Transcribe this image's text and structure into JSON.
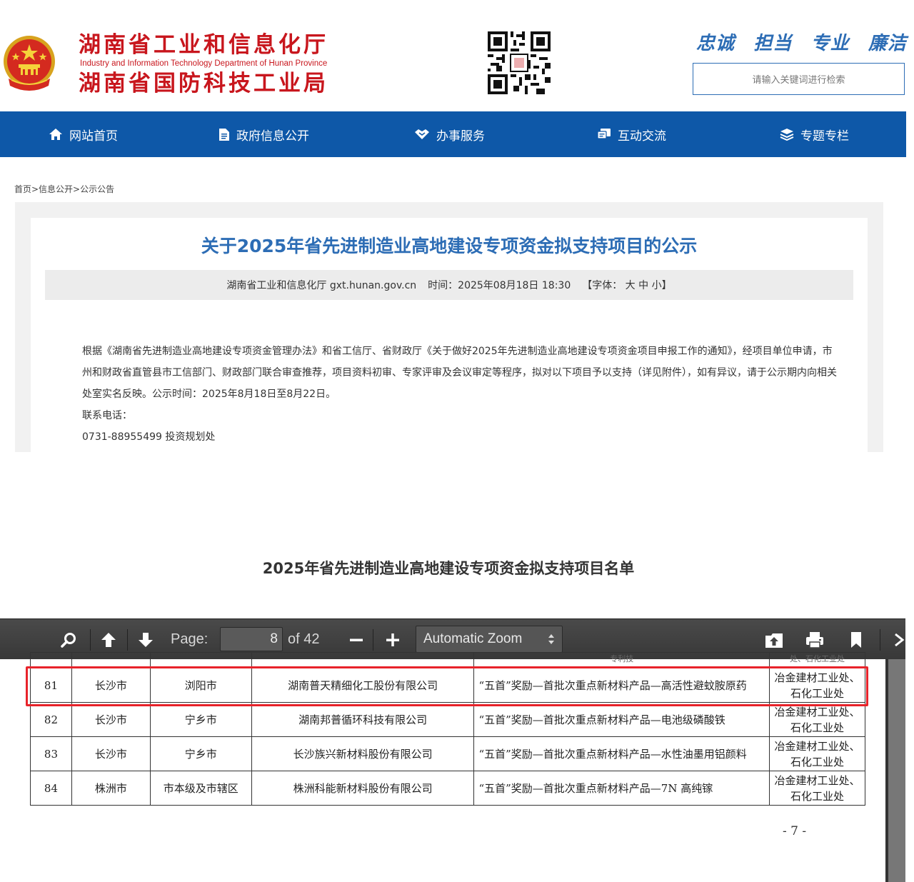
{
  "header": {
    "org_name_1": "湖南省工业和信息化厅",
    "org_name_en": "Industry and Information Technology Department of Hunan Province",
    "org_name_2": "湖南省国防科技工业局",
    "motto": [
      "忠诚",
      "担当",
      "专业",
      "廉洁"
    ],
    "search_placeholder": "请输入关键词进行检索"
  },
  "nav": {
    "items": [
      {
        "label": "网站首页",
        "icon": "home-icon"
      },
      {
        "label": "政府信息公开",
        "icon": "document-icon"
      },
      {
        "label": "办事服务",
        "icon": "handshake-icon"
      },
      {
        "label": "互动交流",
        "icon": "chat-icon"
      },
      {
        "label": "专题专栏",
        "icon": "layers-icon"
      }
    ]
  },
  "breadcrumb": "首页>信息公开>公示公告",
  "article": {
    "title": "关于2025年省先进制造业高地建设专项资金拟支持项目的公示",
    "source": "湖南省工业和信息化厅 gxt.hunan.gov.cn",
    "time": "时间：2025年08月18日 18:30",
    "font_size": "【字体：  大  中  小】",
    "paragraph_1": "根据《湖南省先进制造业高地建设专项资金管理办法》和省工信厅、省财政厅《关于做好2025年先进制造业高地建设专项资金项目申报工作的通知》，经项目单位申请，市州和财政省直管县市工信部门、财政部门联合审查推荐，项目资料初审、专家评审及会议审定等程序，拟对以下项目予以支持（详见附件），如有异议，请于公示期内向相关处室实名反映。公示时间：2025年8月18日至8月22日。",
    "contact_label": "联系电话：",
    "contact_phone": "0731-88955499  投资规划处"
  },
  "list_title": "2025年省先进制造业高地建设专项资金拟支持项目名单",
  "pdf_toolbar": {
    "page_label": "Page:",
    "page_value": "8",
    "page_total": "of 42",
    "zoom": "Automatic Zoom"
  },
  "table": {
    "top_partial": [
      "",
      "",
      "",
      "",
      "专利技",
      "处、石化工业处"
    ],
    "rows": [
      {
        "no": "81",
        "city": "长沙市",
        "county": "浏阳市",
        "company": "湖南普天精细化工股份有限公司",
        "project": "“五首”奖励—首批次重点新材料产品—高活性避蚊胺原药",
        "dept": "冶金建材工业处、石化工业处"
      },
      {
        "no": "82",
        "city": "长沙市",
        "county": "宁乡市",
        "company": "湖南邦普循环科技有限公司",
        "project": "“五首”奖励—首批次重点新材料产品—电池级磷酸铁",
        "dept": "冶金建材工业处、石化工业处"
      },
      {
        "no": "83",
        "city": "长沙市",
        "county": "宁乡市",
        "company": "长沙族兴新材料股份有限公司",
        "project": "“五首”奖励—首批次重点新材料产品—水性油墨用铝颜料",
        "dept": "冶金建材工业处、石化工业处"
      },
      {
        "no": "84",
        "city": "株洲市",
        "county": "市本级及市辖区",
        "company": "株洲科能新材料股份有限公司",
        "project": "“五首”奖励—首批次重点新材料产品—7N 高纯镓",
        "dept": "冶金建材工业处、石化工业处"
      }
    ]
  },
  "page_number": "- 7 -",
  "colors": {
    "brand_red": "#c8161d",
    "brand_blue": "#2d6db5",
    "nav_blue": "#0e58a8",
    "highlight_red": "#e8232a"
  }
}
